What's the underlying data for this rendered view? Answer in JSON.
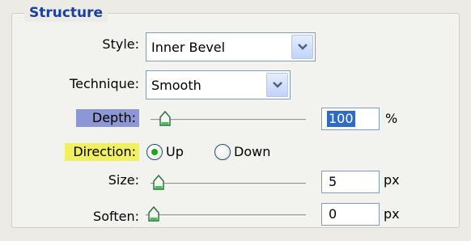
{
  "section": {
    "title": "Structure"
  },
  "style": {
    "label": "Style:",
    "value": "Inner Bevel"
  },
  "technique": {
    "label": "Technique:",
    "value": "Smooth"
  },
  "depth": {
    "label": "Depth:",
    "value": "100",
    "unit": "%",
    "highlight_color": "#8e97d6"
  },
  "direction": {
    "label": "Direction:",
    "highlight_color": "#f0f060",
    "options": [
      "Up",
      "Down"
    ],
    "selected": "Up"
  },
  "size": {
    "label": "Size:",
    "value": "5",
    "unit": "px"
  },
  "soften": {
    "label": "Soften:",
    "value": "0",
    "unit": "px"
  },
  "colors": {
    "legend": "#1b3fa0",
    "input_border": "#7f9db9",
    "selection": "#316ac5",
    "radio_dot": "#21a121"
  }
}
